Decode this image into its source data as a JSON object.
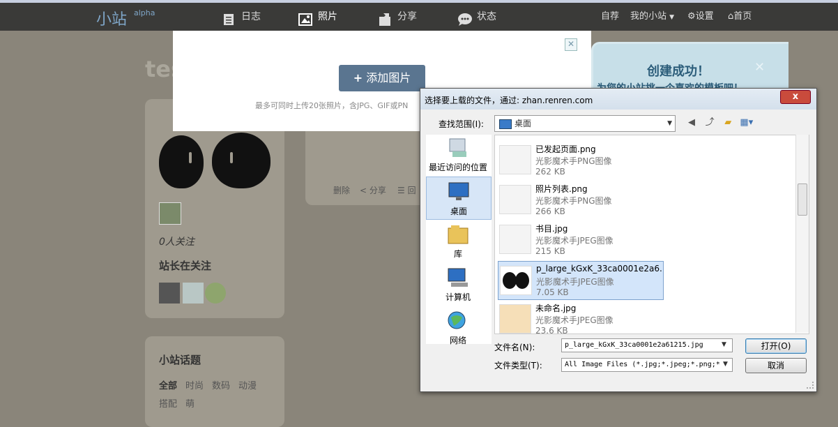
{
  "nav": {
    "logo": "小站",
    "logo_sup": "alpha",
    "items": [
      {
        "label": "日志"
      },
      {
        "label": "照片"
      },
      {
        "label": "分享"
      },
      {
        "label": "状态"
      }
    ],
    "right": {
      "save": "自荐",
      "my_site": "我的小站",
      "settings": "设置",
      "home": "首页"
    }
  },
  "page": {
    "title_fragment": "tes",
    "followers": "0人关注",
    "following_title": "站长在关注",
    "topics": {
      "title": "小站话题",
      "tags": [
        "全部",
        "时尚",
        "数码",
        "动漫",
        "搭配",
        "萌"
      ]
    },
    "post_actions": [
      "删除",
      "分享",
      "回"
    ]
  },
  "upload": {
    "add_button": "添加图片",
    "hint": "最多可同时上传20张照片，含JPG、GIF或PN"
  },
  "bubble": {
    "title": "创建成功！",
    "subtitle": "为您的小站挑一个喜欢的模板吧！"
  },
  "dialog": {
    "title": "选择要上载的文件，通过: zhan.renren.com",
    "close_label": "x",
    "look_in_label": "查找范围(I):",
    "look_in_value": "桌面",
    "places": [
      "最近访问的位置",
      "桌面",
      "库",
      "计算机",
      "网络"
    ],
    "files": [
      {
        "name": "已发起页面.png",
        "type": "光影魔术手PNG图像",
        "size": "262 KB"
      },
      {
        "name": "照片列表.png",
        "type": "光影魔术手PNG图像",
        "size": "266 KB"
      },
      {
        "name": "书目.jpg",
        "type": "光影魔术手JPEG图像",
        "size": "215 KB"
      },
      {
        "name": "p_large_kGxK_33ca0001e2a6...",
        "type": "光影魔术手JPEG图像",
        "size": "7.05 KB"
      },
      {
        "name": "未命名.jpg",
        "type": "光影魔术手JPEG图像",
        "size": "23.6 KB"
      }
    ],
    "filename_label": "文件名(N):",
    "filename_value": "p_large_kGxK_33ca0001e2a61215.jpg",
    "filetype_label": "文件类型(T):",
    "filetype_value": "All Image Files (*.jpg;*.jpeg;*.png;*",
    "open_button": "打开(O)",
    "cancel_button": "取消"
  }
}
